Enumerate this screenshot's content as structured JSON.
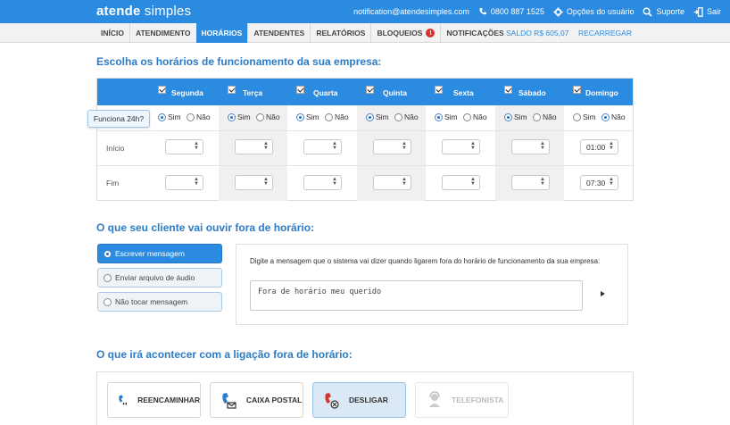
{
  "header": {
    "brand_bold": "atende",
    "brand_light": " simples",
    "email": "notification@atendesimples.com",
    "phone": "0800 887 1525",
    "options": "Opções do usuário",
    "support": "Suporte",
    "logout": "Sair"
  },
  "nav": {
    "tabs": [
      "INÍCIO",
      "ATENDIMENTO",
      "HORÁRIOS",
      "ATENDENTES",
      "RELATÓRIOS",
      "BLOQUEIOS",
      "NOTIFICAÇÕES"
    ],
    "active_tab": "HORÁRIOS",
    "badge": "!",
    "balance": "SALDO R$ 605,07",
    "recharge": "RECARREGAR"
  },
  "schedule": {
    "title": "Escolha os horários de funcionamento da sua empresa:",
    "days": [
      "Segunda",
      "Terça",
      "Quarta",
      "Quinta",
      "Sexta",
      "Sábado",
      "Domingo"
    ],
    "tooltip": "Funciona 24h?",
    "yes": "Sim",
    "no": "Não",
    "row_start": "Início",
    "row_end": "Fim",
    "sunday_start": "01:00",
    "sunday_end": "07:30"
  },
  "after_hours": {
    "title": "O que seu cliente vai ouvir fora de horário:",
    "options": [
      "Escrever mensagem",
      "Enviar arquivo de áudio",
      "Não tocar mensagem"
    ],
    "prompt": "Digite a mensagem que o sistema vai dizer quando ligarem fora do horário de funcionamento da sua empresa:",
    "message": "Fora de horário meu querido"
  },
  "call_action": {
    "title": "O que irá acontecer com a ligação fora de horário:",
    "actions": [
      "REENCAMINHAR",
      "CAIXA POSTAL",
      "DESLIGAR",
      "TELEFONISTA"
    ]
  },
  "colors": {
    "primary": "#2b8be0",
    "title": "#2b7bc7",
    "alert": "#d9322e"
  }
}
